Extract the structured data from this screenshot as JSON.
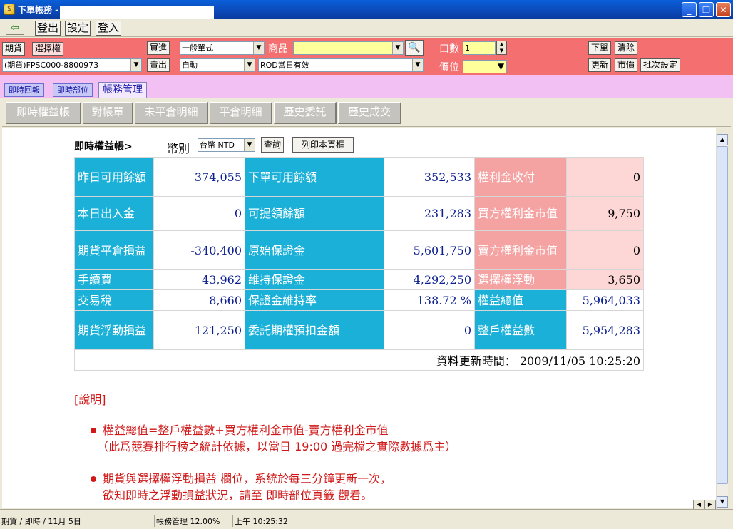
{
  "window": {
    "title": "下單帳務 -",
    "minimize": "_",
    "maximize": "❐",
    "close": "✕"
  },
  "menu": {
    "items": [
      "登出",
      "設定",
      "登入"
    ]
  },
  "order": {
    "futures_btn": "期貨",
    "options_btn": "選擇權",
    "account": "(期貨)FPSC000-8800973",
    "buy_btn": "買進",
    "sell_btn": "賣出",
    "order_type": "一般單式",
    "auto_mode": "自動",
    "product_label": "商品",
    "product_value": "",
    "condition": "ROD當日有效",
    "qty_label": "口數",
    "qty_value": "1",
    "price_label": "價位",
    "price_value": "",
    "place_btn": "下單",
    "clear_btn": "清除",
    "update_btn": "更新",
    "market_btn": "市價",
    "batch_btn": "批次設定"
  },
  "tabs1": [
    "即時回報",
    "即時部位",
    "帳務管理"
  ],
  "tabs2": [
    "即時權益帳",
    "對帳單",
    "未平倉明細",
    "平倉明細",
    "歷史委託",
    "歷史成交"
  ],
  "controls": {
    "title": "即時權益帳>",
    "currency_label": "幣別",
    "currency_value": "台幣 NTD",
    "query_btn": "查詢",
    "print_btn": "列印本頁框"
  },
  "table": {
    "rows": [
      [
        {
          "k": "昨日可用餘額",
          "v": "374,055"
        },
        {
          "k": "下單可用餘額",
          "v": "352,533"
        },
        {
          "k": "權利金收付",
          "v": "0"
        }
      ],
      [
        {
          "k": "本日出入金",
          "v": "0"
        },
        {
          "k": "可提領餘額",
          "v": "231,283"
        },
        {
          "k": "買方權利金市值",
          "v": "9,750"
        }
      ],
      [
        {
          "k": "期貨平倉損益",
          "v": "-340,400"
        },
        {
          "k": "原始保證金",
          "v": "5,601,750"
        },
        {
          "k": "賣方權利金市值",
          "v": "0"
        }
      ],
      [
        {
          "k": "手續費",
          "v": "43,962"
        },
        {
          "k": "維持保證金",
          "v": "4,292,250"
        },
        {
          "k": "選擇權浮動",
          "v": "3,650"
        }
      ],
      [
        {
          "k": "交易稅",
          "v": "8,660"
        },
        {
          "k": "保證金維持率",
          "v": "138.72 %"
        },
        {
          "k": "權益總值",
          "v": "5,964,033"
        }
      ],
      [
        {
          "k": "期貨浮動損益",
          "v": "121,250"
        },
        {
          "k": "委託期權預扣金額",
          "v": "0"
        },
        {
          "k": "整戶權益數",
          "v": "5,954,283"
        }
      ]
    ],
    "update_label": "資料更新時間：",
    "update_time": "2009/11/05 10:25:20"
  },
  "notes": {
    "title": "[說明]",
    "line1": "權益總值=整戶權益數+買方權利金市值-賣方權利金市值",
    "line2": "（此爲競賽排行榜之統計依據，以當日 19:00 過完檔之實際數據爲主）",
    "line3": "期貨與選擇權浮動損益 欄位，系統於每三分鐘更新一次，",
    "line4a": "欲知即時之浮動損益狀況，請至",
    "line4link": "即時部位頁籤",
    "line4b": "觀看。"
  },
  "status": {
    "left": "期貨 / 即時 / 11月 5日",
    "mid": "帳務管理  12.00%",
    "right": "上午 10:25:32"
  }
}
